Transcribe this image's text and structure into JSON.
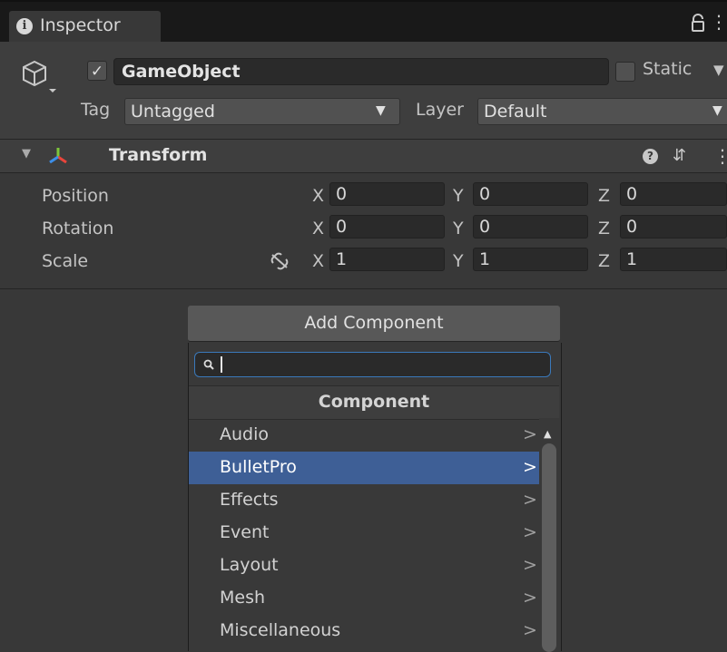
{
  "tab": {
    "label": "Inspector"
  },
  "header": {
    "object_name": "GameObject",
    "active_check": "✓",
    "static_label": "Static",
    "tag_label": "Tag",
    "tag_value": "Untagged",
    "layer_label": "Layer",
    "layer_value": "Default"
  },
  "transform": {
    "title": "Transform",
    "rows": [
      {
        "label": "Position",
        "x": "0",
        "y": "0",
        "z": "0"
      },
      {
        "label": "Rotation",
        "x": "0",
        "y": "0",
        "z": "0"
      },
      {
        "label": "Scale",
        "x": "1",
        "y": "1",
        "z": "1"
      }
    ],
    "axis_labels": {
      "x": "X",
      "y": "Y",
      "z": "Z"
    }
  },
  "add_component": {
    "button_label": "Add Component",
    "search_value": "",
    "category_title": "Component",
    "items": [
      {
        "label": "Audio",
        "selected": false
      },
      {
        "label": "BulletPro",
        "selected": true
      },
      {
        "label": "Effects",
        "selected": false
      },
      {
        "label": "Event",
        "selected": false
      },
      {
        "label": "Layout",
        "selected": false
      },
      {
        "label": "Mesh",
        "selected": false
      },
      {
        "label": "Miscellaneous",
        "selected": false
      }
    ],
    "chevron": ">"
  },
  "colors": {
    "background": "#383838",
    "selection": "#3e5f96",
    "search_focus": "#3a79bb"
  },
  "icons": [
    "info-icon",
    "lock-icon",
    "kebab-menu-icon",
    "gameobject-cube-icon",
    "transform-gizmo-icon",
    "help-icon",
    "presets-icon",
    "link-icon",
    "search-icon",
    "chevron-right-icon",
    "scroll-up-icon"
  ]
}
